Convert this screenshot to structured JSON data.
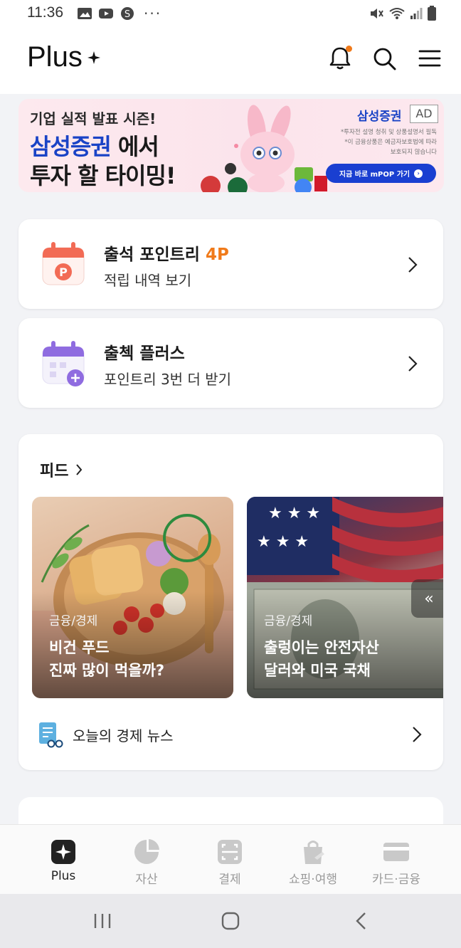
{
  "status_bar": {
    "time": "11:36",
    "more": "···"
  },
  "header": {
    "logo": "Plus",
    "has_notification": true
  },
  "ad_banner": {
    "line1": "기업 실적 발표 시즌!",
    "line2_brand": "삼성증권",
    "line2_rest": " 에서",
    "line3": "투자 할 타이밍!",
    "brand": "삼성증권",
    "ad_tag": "AD",
    "disclaimer": [
      "*투자전 설명 청취 및 상품설명서 필독",
      "*이 금융상품은 예금자보호법에 따라",
      "보호되지 않습니다"
    ],
    "cta_label": "지금 바로 mPOP 가기"
  },
  "cards": [
    {
      "title": "출석 포인트리",
      "points": "4P",
      "subtitle": "적립 내역 보기"
    },
    {
      "title": "출첵 플러스",
      "subtitle": "포인트리 3번 더 받기"
    }
  ],
  "feed": {
    "title": "피드",
    "tiles": [
      {
        "category": "금융/경제",
        "headline1": "비건 푸드",
        "headline2": "진짜 많이 먹을까?"
      },
      {
        "category": "금융/경제",
        "headline1": "출렁이는 안전자산",
        "headline2": "달러와 미국 국채"
      }
    ],
    "collapse_glyph": "«",
    "news_label": "오늘의 경제 뉴스"
  },
  "bottom_nav": [
    {
      "label": "Plus",
      "icon": "plus-sparkle-icon",
      "active": true
    },
    {
      "label": "자산",
      "icon": "pie-chart-icon",
      "active": false
    },
    {
      "label": "결제",
      "icon": "scan-icon",
      "active": false
    },
    {
      "label": "쇼핑·여행",
      "icon": "shopping-bag-icon",
      "active": false
    },
    {
      "label": "카드·금융",
      "icon": "card-icon",
      "active": false
    }
  ],
  "colors": {
    "accent": "#f07a1a",
    "brand_blue": "#1a43c6",
    "cta_blue": "#1a3fd1"
  }
}
